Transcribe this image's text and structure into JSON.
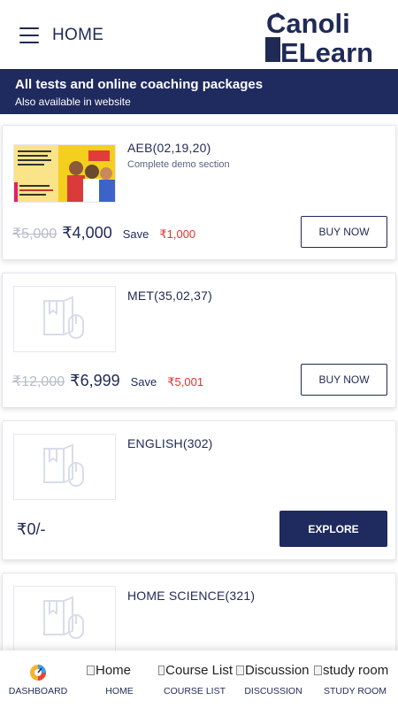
{
  "header": {
    "title": "HOME",
    "logo_line1": "Canoli",
    "logo_line2": "ELearn"
  },
  "banner": {
    "title": "All tests and online coaching packages",
    "subtitle": "Also available in website"
  },
  "courses": [
    {
      "name": "AEB(02,19,20)",
      "description": "Complete demo section",
      "old_price": "₹5,000",
      "price": "₹4,000",
      "save_label": "Save",
      "save_amount": "₹1,000",
      "button": "BUY NOW"
    },
    {
      "name": "MET(35,02,37)",
      "description": "",
      "old_price": "₹12,000",
      "price": "₹6,999",
      "save_label": "Save",
      "save_amount": "₹5,001",
      "button": "BUY NOW"
    },
    {
      "name": "ENGLISH(302)",
      "description": "",
      "price": "₹0/-",
      "button": "EXPLORE"
    },
    {
      "name": "HOME SCIENCE(321)",
      "description": ""
    }
  ],
  "bottom_nav": [
    {
      "label": "DASHBOARD",
      "icon": "dashboard-icon"
    },
    {
      "label": "HOME",
      "alt": "Home"
    },
    {
      "label": "COURSE LIST",
      "alt": "Course List"
    },
    {
      "label": "DISCUSSION",
      "alt": "Discussion"
    },
    {
      "label": "STUDY ROOM",
      "alt": "study room"
    }
  ],
  "colors": {
    "primary": "#1f2a5e",
    "save_red": "#e0322f",
    "strike_gray": "#b7bcc9"
  }
}
